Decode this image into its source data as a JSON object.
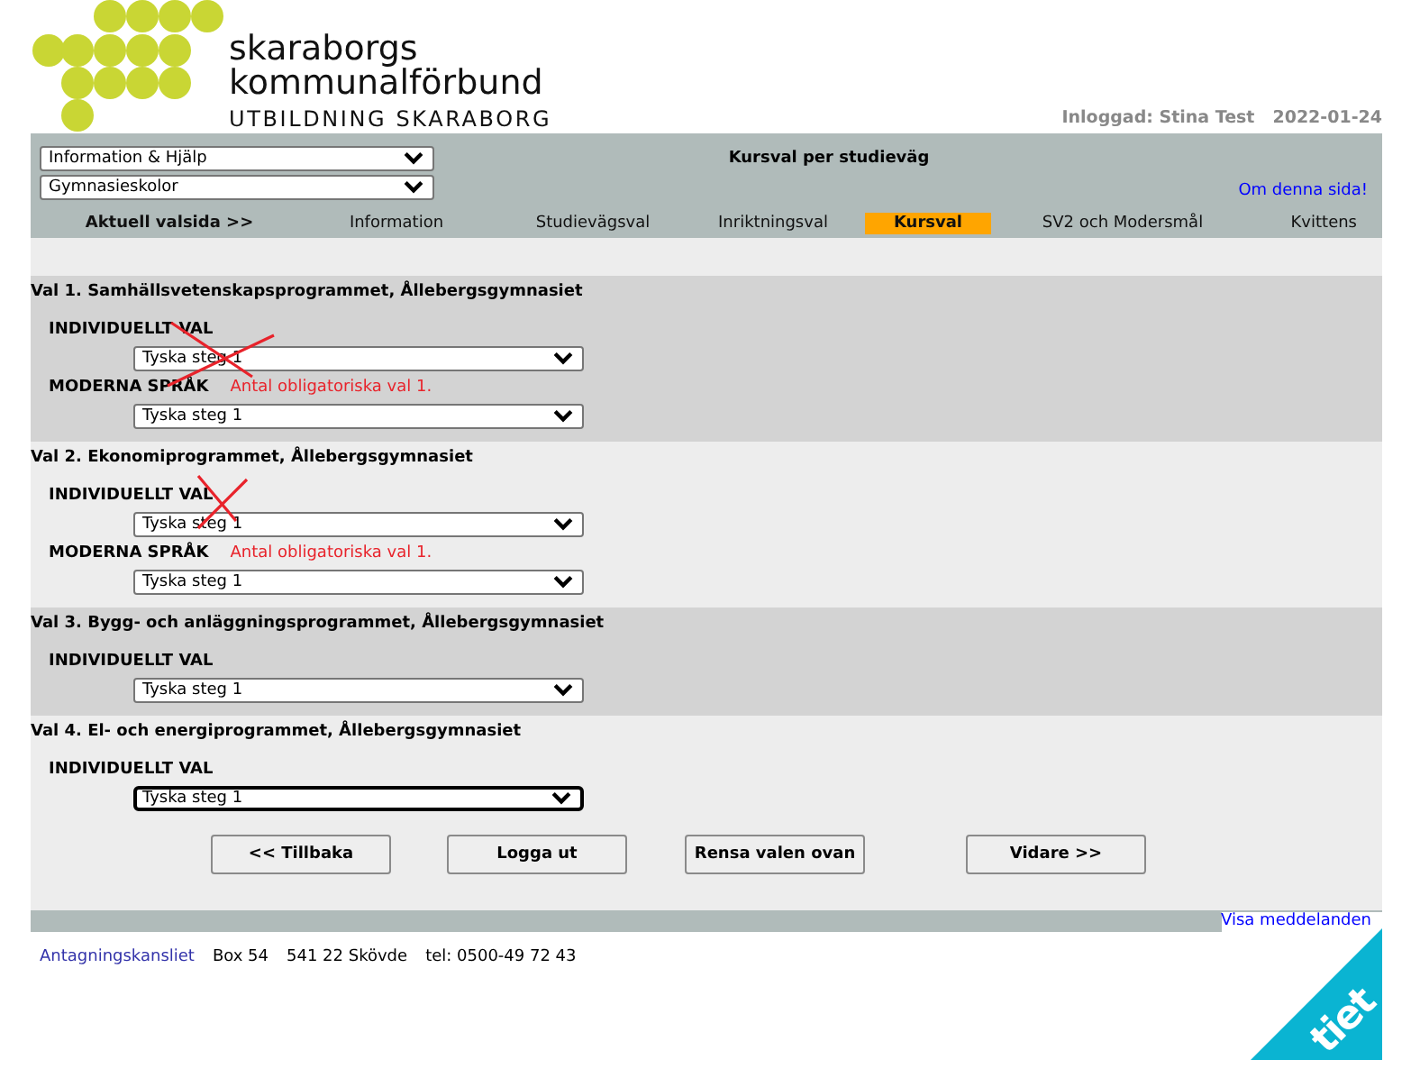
{
  "header": {
    "logo_name": "skaraborgs",
    "logo_name_2": "kommunalförbund",
    "logo_subtitle": "UTBILDNING SKARABORG",
    "logged_in": "Inloggad: Stina Test",
    "date": "2022-01-24"
  },
  "navbar": {
    "dropdowns": [
      {
        "value": "Information & Hjälp"
      },
      {
        "value": "Gymnasieskolor"
      }
    ],
    "title": "Kursval per studieväg",
    "help_link": "Om denna sida!",
    "current_label": "Aktuell valsida >>",
    "tabs": [
      {
        "label": "Information",
        "selected": false
      },
      {
        "label": "Studievägsval",
        "selected": false
      },
      {
        "label": "Inriktningsval",
        "selected": false
      },
      {
        "label": "Kursval",
        "selected": true
      },
      {
        "label": "SV2 och Modersmål",
        "selected": false
      },
      {
        "label": "Kvittens",
        "selected": false
      }
    ]
  },
  "sections": [
    {
      "title": "Val 1. Samhällsvetenskapsprogrammet, Ållebergsgymnasiet",
      "shaded": true,
      "groups": [
        {
          "label": "INDIVIDUELLT VAL",
          "value": "Tyska steg 1",
          "focused": false,
          "crossed": true
        },
        {
          "label": "MODERNA SPRÅK",
          "error": "Antal obligatoriska val 1.",
          "value": "Tyska steg 1",
          "focused": false,
          "crossed": false
        }
      ]
    },
    {
      "title": "Val 2. Ekonomiprogrammet, Ållebergsgymnasiet",
      "shaded": false,
      "groups": [
        {
          "label": "INDIVIDUELLT VAL",
          "value": "Tyska steg 1",
          "focused": false,
          "crossed": true
        },
        {
          "label": "MODERNA SPRÅK",
          "error": "Antal obligatoriska val 1.",
          "value": "Tyska steg 1",
          "focused": false,
          "crossed": false
        }
      ]
    },
    {
      "title": "Val 3. Bygg- och anläggningsprogrammet, Ållebergsgymnasiet",
      "shaded": true,
      "groups": [
        {
          "label": "INDIVIDUELLT VAL",
          "value": "Tyska steg 1",
          "focused": false,
          "crossed": false
        }
      ]
    },
    {
      "title": "Val 4. El- och energiprogrammet, Ållebergsgymnasiet",
      "shaded": false,
      "groups": [
        {
          "label": "INDIVIDUELLT VAL",
          "value": "Tyska steg 1",
          "focused": true,
          "crossed": false
        }
      ]
    }
  ],
  "buttons": [
    "<< Tillbaka",
    "Logga ut",
    "Rensa valen ovan",
    "Vidare  >>"
  ],
  "messages_link": "Visa meddelanden",
  "footer": {
    "link": "Antagningskansliet",
    "address": "Box 54",
    "postal": "541 22 Skövde",
    "phone": "tel: 0500-49 72 43"
  },
  "brand": "tiet"
}
